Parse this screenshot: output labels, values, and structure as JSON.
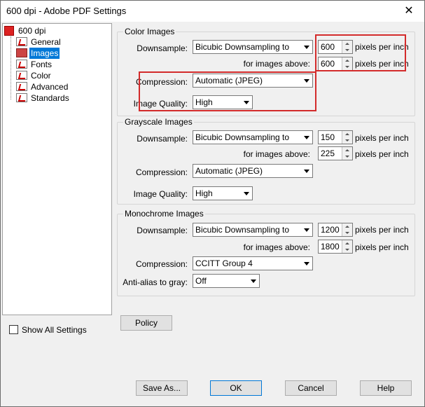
{
  "window": {
    "title": "600 dpi - Adobe PDF Settings",
    "close": "✕"
  },
  "tree": {
    "root": "600 dpi",
    "items": [
      {
        "label": "General"
      },
      {
        "label": "Images"
      },
      {
        "label": "Fonts"
      },
      {
        "label": "Color"
      },
      {
        "label": "Advanced"
      },
      {
        "label": "Standards"
      }
    ]
  },
  "show_all": {
    "label": "Show All Settings",
    "checked": false
  },
  "color": {
    "title": "Color Images",
    "downsample_label": "Downsample:",
    "downsample_value": "Bicubic Downsampling to",
    "dpi": "600",
    "above_label": "for images above:",
    "above": "600",
    "compression_label": "Compression:",
    "compression": "Automatic (JPEG)",
    "quality_label": "Image Quality:",
    "quality": "High"
  },
  "gray": {
    "title": "Grayscale Images",
    "downsample_label": "Downsample:",
    "downsample_value": "Bicubic Downsampling to",
    "dpi": "150",
    "above_label": "for images above:",
    "above": "225",
    "compression_label": "Compression:",
    "compression": "Automatic (JPEG)",
    "quality_label": "Image Quality:",
    "quality": "High"
  },
  "mono": {
    "title": "Monochrome Images",
    "downsample_label": "Downsample:",
    "downsample_value": "Bicubic Downsampling to",
    "dpi": "1200",
    "above_label": "for images above:",
    "above": "1800",
    "compression_label": "Compression:",
    "compression": "CCITT Group 4",
    "antialias_label": "Anti-alias to gray:",
    "antialias": "Off"
  },
  "units": {
    "ppi": "pixels per inch"
  },
  "buttons": {
    "policy": "Policy",
    "save_as": "Save As...",
    "ok": "OK",
    "cancel": "Cancel",
    "help": "Help"
  },
  "highlight_color": "#d32b2b"
}
